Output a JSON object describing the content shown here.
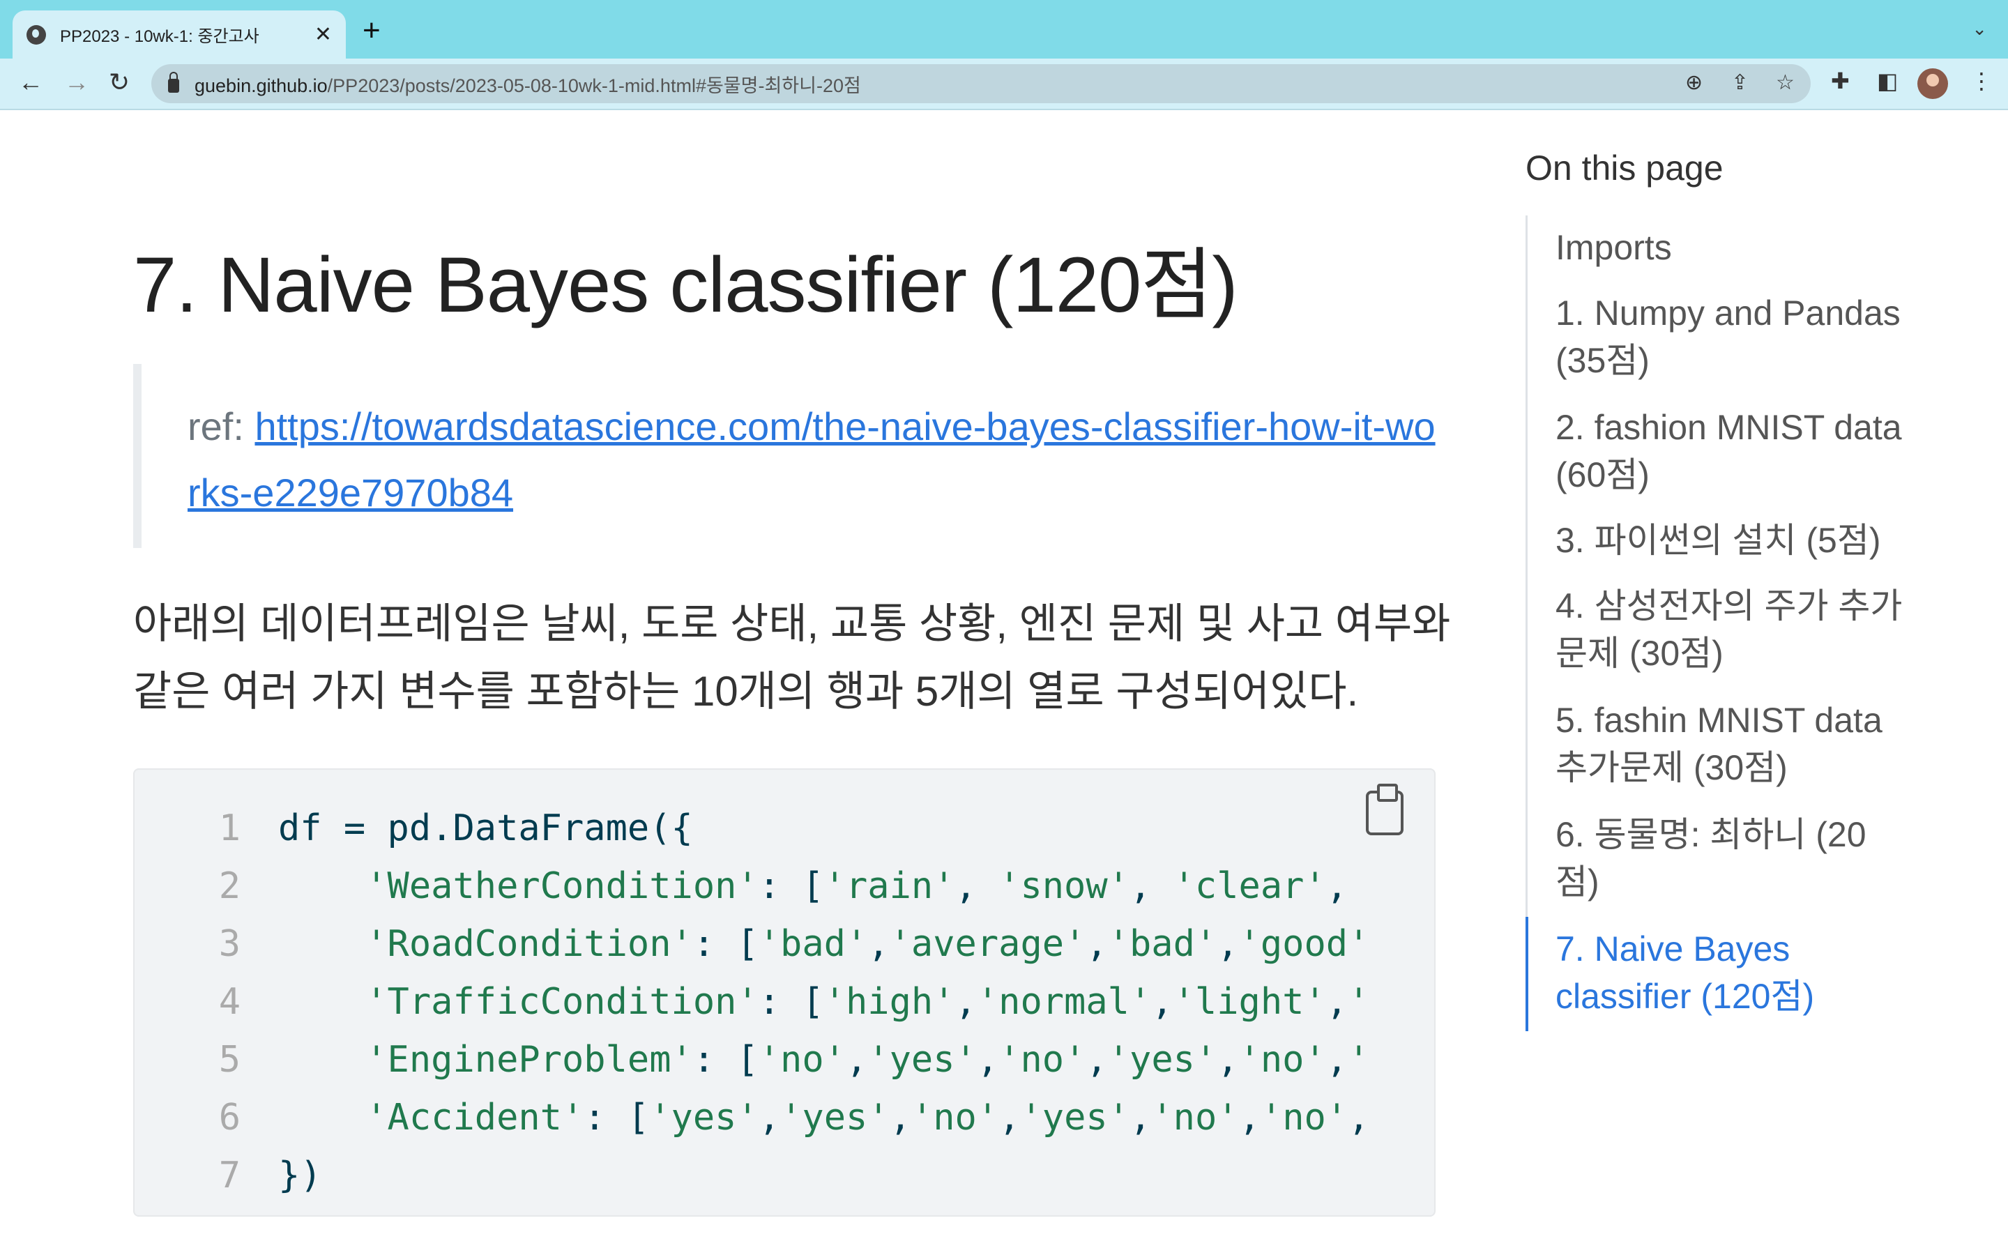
{
  "browser": {
    "tab_title": "PP2023 - 10wk-1: 중간고사",
    "url_host": "guebin.github.io",
    "url_path": "/PP2023/posts/2023-05-08-10wk-1-mid.html#동물명-최하니-20점",
    "icons": [
      "globe-icon",
      "close-icon",
      "plus-icon",
      "back-icon",
      "forward-icon",
      "reload-icon",
      "lock-icon",
      "zoom-icon",
      "share-icon",
      "star-icon",
      "extensions-icon",
      "sidepanel-icon",
      "avatar",
      "menu-icon"
    ]
  },
  "main": {
    "heading": "7. Naive Bayes classifier (120점)",
    "ref_label": "ref: ",
    "ref_link": "https://towardsdatascience.com/the-naive-bayes-classifier-how-it-works-e229e7970b84",
    "paragraph": "아래의 데이터프레임은 날씨, 도로 상태, 교통 상황, 엔진 문제 및 사고 여부와 같은 여러 가지 변수를 포함하는 10개의 행과 5개의 열로 구성되어있다.",
    "code": [
      {
        "n": "1",
        "tokens": [
          {
            "t": "df = pd.DataFrame({",
            "c": "d"
          }
        ]
      },
      {
        "n": "2",
        "tokens": [
          {
            "t": "    'WeatherCondition'",
            "c": "s"
          },
          {
            "t": ": [",
            "c": "d"
          },
          {
            "t": "'rain'",
            "c": "s"
          },
          {
            "t": ", ",
            "c": "d"
          },
          {
            "t": "'snow'",
            "c": "s"
          },
          {
            "t": ", ",
            "c": "d"
          },
          {
            "t": "'clear'",
            "c": "s"
          },
          {
            "t": ",",
            "c": "d"
          }
        ]
      },
      {
        "n": "3",
        "tokens": [
          {
            "t": "    'RoadCondition'",
            "c": "s"
          },
          {
            "t": ": [",
            "c": "d"
          },
          {
            "t": "'bad'",
            "c": "s"
          },
          {
            "t": ",",
            "c": "d"
          },
          {
            "t": "'average'",
            "c": "s"
          },
          {
            "t": ",",
            "c": "d"
          },
          {
            "t": "'bad'",
            "c": "s"
          },
          {
            "t": ",",
            "c": "d"
          },
          {
            "t": "'good'",
            "c": "s"
          }
        ]
      },
      {
        "n": "4",
        "tokens": [
          {
            "t": "    'TrafficCondition'",
            "c": "s"
          },
          {
            "t": ": [",
            "c": "d"
          },
          {
            "t": "'high'",
            "c": "s"
          },
          {
            "t": ",",
            "c": "d"
          },
          {
            "t": "'normal'",
            "c": "s"
          },
          {
            "t": ",",
            "c": "d"
          },
          {
            "t": "'light'",
            "c": "s"
          },
          {
            "t": ",",
            "c": "d"
          },
          {
            "t": "'",
            "c": "s"
          }
        ]
      },
      {
        "n": "5",
        "tokens": [
          {
            "t": "    'EngineProblem'",
            "c": "s"
          },
          {
            "t": ": [",
            "c": "d"
          },
          {
            "t": "'no'",
            "c": "s"
          },
          {
            "t": ",",
            "c": "d"
          },
          {
            "t": "'yes'",
            "c": "s"
          },
          {
            "t": ",",
            "c": "d"
          },
          {
            "t": "'no'",
            "c": "s"
          },
          {
            "t": ",",
            "c": "d"
          },
          {
            "t": "'yes'",
            "c": "s"
          },
          {
            "t": ",",
            "c": "d"
          },
          {
            "t": "'no'",
            "c": "s"
          },
          {
            "t": ",",
            "c": "d"
          },
          {
            "t": "'",
            "c": "s"
          }
        ]
      },
      {
        "n": "6",
        "tokens": [
          {
            "t": "    'Accident'",
            "c": "s"
          },
          {
            "t": ": [",
            "c": "d"
          },
          {
            "t": "'yes'",
            "c": "s"
          },
          {
            "t": ",",
            "c": "d"
          },
          {
            "t": "'yes'",
            "c": "s"
          },
          {
            "t": ",",
            "c": "d"
          },
          {
            "t": "'no'",
            "c": "s"
          },
          {
            "t": ",",
            "c": "d"
          },
          {
            "t": "'yes'",
            "c": "s"
          },
          {
            "t": ",",
            "c": "d"
          },
          {
            "t": "'no'",
            "c": "s"
          },
          {
            "t": ",",
            "c": "d"
          },
          {
            "t": "'no'",
            "c": "s"
          },
          {
            "t": ",",
            "c": "d"
          }
        ]
      },
      {
        "n": "7",
        "tokens": [
          {
            "t": "})",
            "c": "d"
          }
        ]
      }
    ]
  },
  "toc": {
    "title": "On this page",
    "items": [
      {
        "label": "Imports"
      },
      {
        "label": "1. Numpy and Pandas (35점)"
      },
      {
        "label": "2. fashion MNIST data (60점)"
      },
      {
        "label": "3. 파이썬의 설치 (5점)"
      },
      {
        "label": "4. 삼성전자의 주가 추가문제 (30점)"
      },
      {
        "label": "5. fashin MNIST data 추가문제 (30점)"
      },
      {
        "label": "6. 동물명: 최하니 (20점)"
      },
      {
        "label": "7. Naive Bayes classifier (120점)",
        "active": true
      }
    ]
  },
  "colors": {
    "accent": "#2a76dd",
    "tabbar": "#80dbe8",
    "string": "#20794d",
    "code_text": "#003b4f"
  }
}
